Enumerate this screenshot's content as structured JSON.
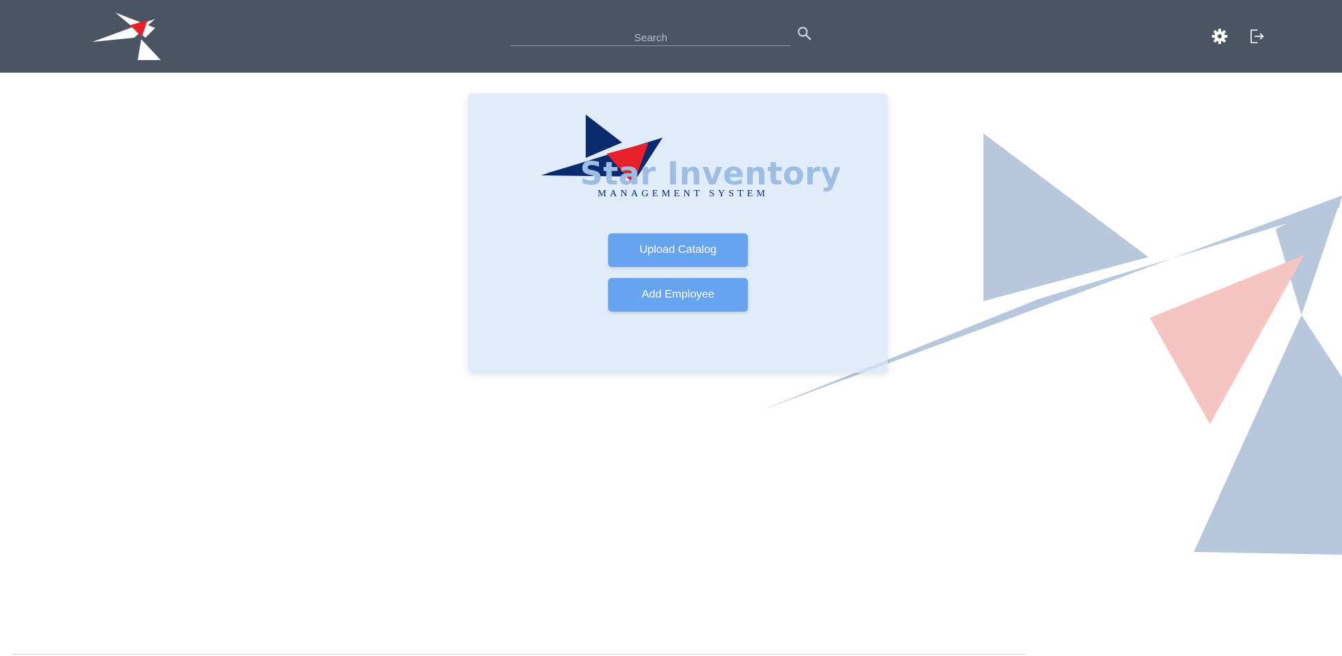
{
  "header": {
    "search": {
      "placeholder": "Search",
      "value": ""
    },
    "icons": {
      "logo": "star-logo-icon",
      "search": "search-icon",
      "settings": "gear-icon",
      "logout": "logout-icon"
    }
  },
  "brand": {
    "name": "Star Inventory",
    "tagline": "MANAGEMENT SYSTEM"
  },
  "actions": {
    "upload_catalog_label": "Upload Catalog",
    "add_employee_label": "Add Employee"
  },
  "colors": {
    "header_bg": "#4a5463",
    "panel_bg": "#d6e5f9",
    "button_bg": "#66a4f0",
    "brand_navy": "#0a2a6e",
    "brand_red": "#e8202a",
    "brand_light_blue": "#9dbde3",
    "decoration_blue": "#b7c7dc",
    "decoration_pink": "#f7c5c1"
  }
}
